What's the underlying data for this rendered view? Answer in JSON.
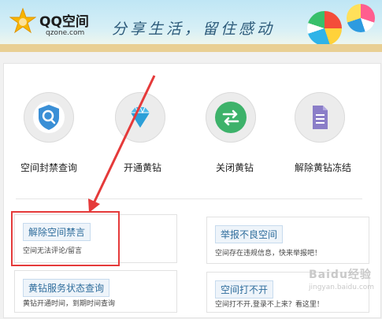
{
  "header": {
    "logo_title": "QQ空间",
    "logo_sub": "qzone.com",
    "slogan": "分享生活，留住感动"
  },
  "icons": [
    {
      "label": "空间封禁查询",
      "icon": "search-shield-icon"
    },
    {
      "label": "开通黄钻",
      "icon": "diamond-icon"
    },
    {
      "label": "关闭黄钻",
      "icon": "swap-arrows-icon"
    },
    {
      "label": "解除黄钻冻结",
      "icon": "document-icon"
    }
  ],
  "services": [
    {
      "title": "解除空间禁言",
      "desc": "空间无法评论/留言"
    },
    {
      "title": "举报不良空间",
      "desc": "空间存在违规信息，快来举报吧！"
    },
    {
      "title": "黄钻服务状态查询",
      "desc": "黄钻开通时间，到期时间查询"
    },
    {
      "title": "空间打不开",
      "desc": "空间打不开,登录不上来？看这里！"
    }
  ],
  "watermark": {
    "text": "Baidu经验",
    "sub": "jingyan.baidu.com"
  },
  "colors": {
    "accent_blue": "#2f6d9c",
    "highlight_red": "#e53a3a"
  }
}
